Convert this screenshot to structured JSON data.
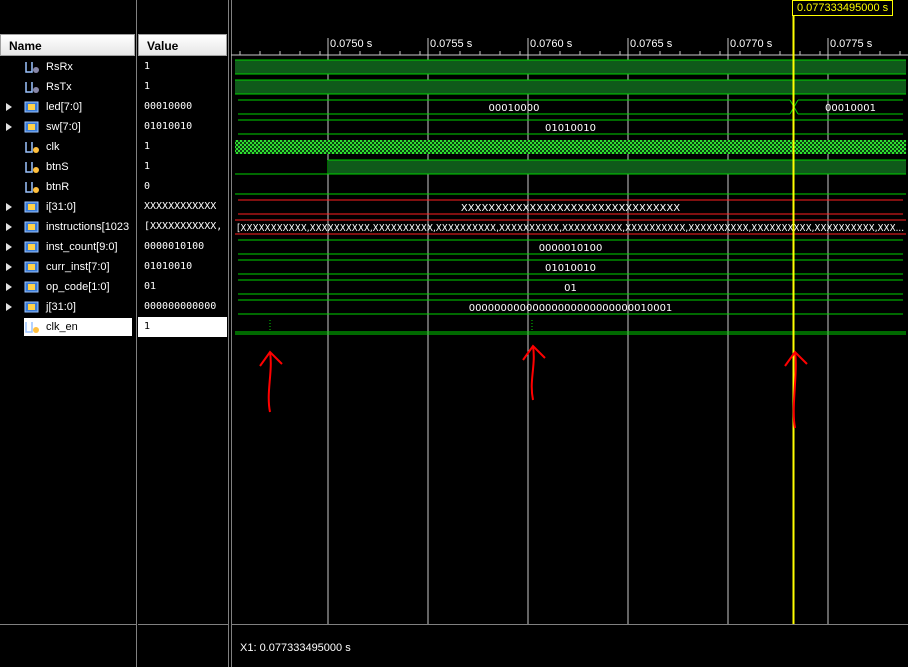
{
  "headers": {
    "name": "Name",
    "value": "Value"
  },
  "cursor": {
    "label": "0.077333495000 s",
    "status": "X1: 0.077333495000 s"
  },
  "ticks": [
    "0.0750 s",
    "0.0755 s",
    "0.0760 s",
    "0.0765 s",
    "0.0770 s",
    "0.0775 s"
  ],
  "signals": [
    {
      "name": "RsRx",
      "value": "1"
    },
    {
      "name": "RsTx",
      "value": "1"
    },
    {
      "name": "led[7:0]",
      "value": "00010000",
      "bus": [
        "00010000",
        "00010001"
      ]
    },
    {
      "name": "sw[7:0]",
      "value": "01010010",
      "bus": [
        "01010010"
      ]
    },
    {
      "name": "clk",
      "value": "1"
    },
    {
      "name": "btnS",
      "value": "1"
    },
    {
      "name": "btnR",
      "value": "0"
    },
    {
      "name": "i[31:0]",
      "value": "XXXXXXXXXXXX",
      "bus": [
        "XXXXXXXXXXXXXXXXXXXXXXXXXXXXXXXX"
      ]
    },
    {
      "name": "instructions[1023",
      "value": "[XXXXXXXXXXX,",
      "bus": [
        "[XXXXXXXXXXX,XXXXXXXXXX,XXXXXXXXXX,XXXXXXXXXX,XXXXXXXXXX,XXXXXXXXXX,XXXXXXXXXX,XXXXXXXXXX,XXXXXXXXXX,XXXXXXXXXX,XXX..."
      ]
    },
    {
      "name": "inst_count[9:0]",
      "value": "0000010100",
      "bus": [
        "0000010100"
      ]
    },
    {
      "name": "curr_inst[7:0]",
      "value": "01010010",
      "bus": [
        "01010010"
      ]
    },
    {
      "name": "op_code[1:0]",
      "value": "01",
      "bus": [
        "01"
      ]
    },
    {
      "name": "j[31:0]",
      "value": "000000000000",
      "bus": [
        "00000000000000000000000000010001"
      ]
    },
    {
      "name": "clk_en",
      "value": "1"
    }
  ],
  "colors": {
    "wave": "#00d200",
    "bus_x": "#ff2020",
    "cursor": "#ffff00",
    "grid": "#c8c8c8",
    "annotation": "#ff0000"
  }
}
